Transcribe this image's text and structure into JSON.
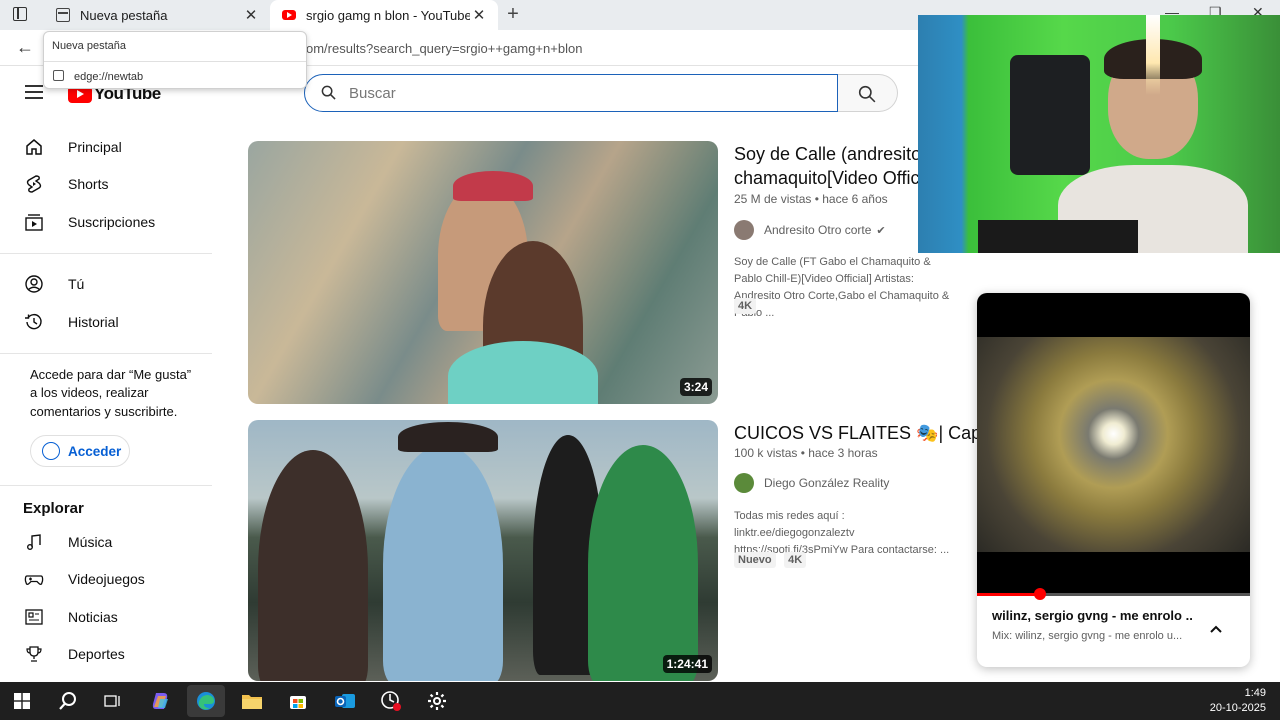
{
  "browser": {
    "tabs": [
      {
        "title": "Nueva pestaña",
        "close": "✕"
      },
      {
        "title": "srgio gamg n blon - YouTube",
        "close": "✕"
      }
    ],
    "new_tab": "+",
    "address": "om/results?search_query=srgio++gamg+n+blon",
    "tooltip": {
      "title": "Nueva pestaña",
      "url": "edge://newtab"
    }
  },
  "youtube": {
    "logo_text": "YouTube",
    "search_placeholder": "Buscar",
    "sidebar": {
      "main": [
        {
          "label": "Principal",
          "icon": "home-icon"
        },
        {
          "label": "Shorts",
          "icon": "shorts-icon"
        },
        {
          "label": "Suscripciones",
          "icon": "subscriptions-icon"
        }
      ],
      "you": [
        {
          "label": "Tú",
          "icon": "user-icon"
        },
        {
          "label": "Historial",
          "icon": "history-icon"
        }
      ],
      "signin_text": "Accede para dar “Me gusta” a los videos, realizar comentarios y suscribirte.",
      "signin_button": "Acceder",
      "explore_title": "Explorar",
      "explore": [
        {
          "label": "Música",
          "icon": "music-icon"
        },
        {
          "label": "Videojuegos",
          "icon": "gamepad-icon"
        },
        {
          "label": "Noticias",
          "icon": "news-icon"
        },
        {
          "label": "Deportes",
          "icon": "trophy-icon"
        }
      ]
    },
    "results": [
      {
        "title_line1": "Soy de Calle (andresito o",
        "title_line2": "chamaquito[Video Officia",
        "meta": "25 M de vistas • hace 6 años",
        "channel": "Andresito Otro corte",
        "verified": true,
        "description": "Soy de Calle (FT Gabo el Chamaquito & Pablo Chill-E)[Video Official] Artistas: Andresito Otro Corte,Gabo el Chamaquito & Pablo ...",
        "badges": [
          "4K"
        ],
        "duration": "3:24"
      },
      {
        "title_line1": "CUICOS VS FLAITES 🎭| Capítulo",
        "meta": "100 k vistas • hace 3 horas",
        "channel": "Diego González Reality",
        "description": "Todas mis redes aquí : linktr.ee/diegogonzaleztv https://spoti.fi/3sPmiYw Para contactarse: ...",
        "badges": [
          "Nuevo",
          "4K"
        ],
        "duration": "1:24:41"
      }
    ],
    "miniplayer": {
      "title": "wilinz, sergio gvng - me enrolo ...",
      "subtitle": "Mix: wilinz, sergio gvng - me enrolo u...",
      "progress": 0.23
    }
  },
  "taskbar": {
    "time": "1:49",
    "date": "20-10-2025",
    "apps": [
      "windows-start-icon",
      "search-icon",
      "task-view-icon",
      "copilot-icon",
      "edge-icon",
      "file-explorer-icon",
      "store-icon",
      "outlook-icon",
      "screen-recorder-icon",
      "settings-icon"
    ]
  },
  "colors": {
    "youtube_red": "#ff0000",
    "link_blue": "#065fd4",
    "search_border": "#1c62b9",
    "taskbar": "#1f1f1f"
  }
}
